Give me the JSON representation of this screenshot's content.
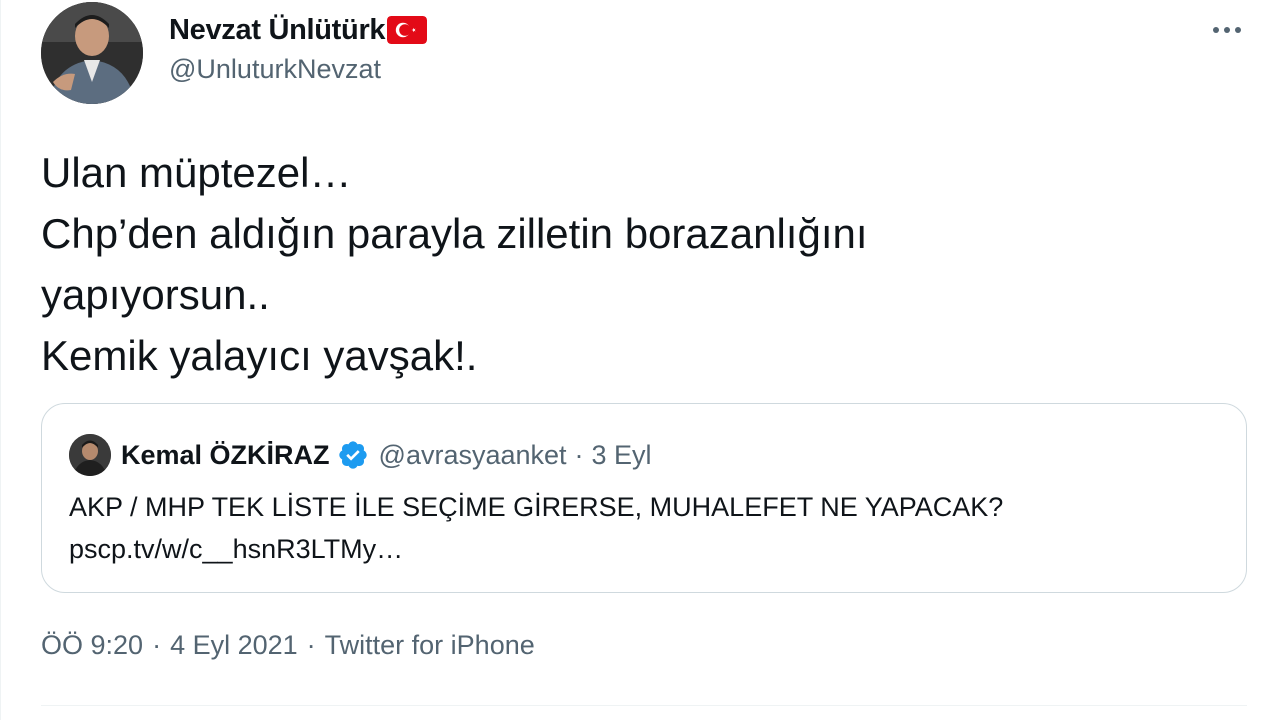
{
  "tweet": {
    "author": {
      "display_name": "Nevzat Ünlütürk",
      "handle": "@UnluturkNevzat",
      "flag_icon": "turkey-flag-icon"
    },
    "more_icon": "more-horizontal-icon",
    "lines": [
      "Ulan müptezel…",
      "Chp’den aldığın parayla zilletin borazanlığını",
      "yapıyorsun..",
      "Kemik yalayıcı yavşak!."
    ],
    "quoted": {
      "display_name": "Kemal ÖZKİRAZ",
      "verified_icon": "verified-badge-icon",
      "handle": "@avrasyaanket",
      "dot": "·",
      "date": "3 Eyl",
      "text": "AKP / MHP TEK LİSTE İLE SEÇİME GİRERSE, MUHALEFET NE YAPACAK?",
      "link": "pscp.tv/w/c__hsnR3LTMy…"
    },
    "meta": {
      "time": "ÖÖ 9:20",
      "sep1": "·",
      "date": "4 Eyl 2021",
      "sep2": "·",
      "source": "Twitter for iPhone"
    }
  },
  "colors": {
    "text": "#0f1419",
    "secondary": "#536471",
    "border": "#cfd9de",
    "verified": "#1d9bf0",
    "flag_red": "#e30a17"
  }
}
